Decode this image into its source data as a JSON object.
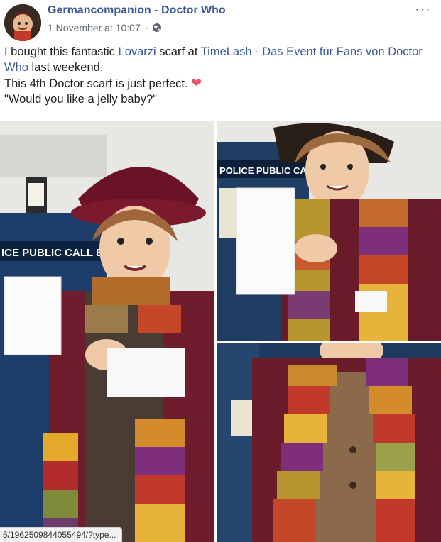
{
  "post": {
    "author": "Germancompanion - Doctor Who",
    "timestamp": "1 November at 10:07",
    "separator": "·",
    "privacy_icon": "globe-icon",
    "more_icon": "more-options-icon",
    "more_label": "···",
    "text": {
      "line1_pre": "I bought this fantastic ",
      "link1": "Lovarzi",
      "line1_mid": " scarf at ",
      "link2": "TimeLash - Das Event für Fans von Doctor Who",
      "line1_post": " last weekend.",
      "line2": "This 4th Doctor scarf is just perfect. ",
      "heart": "❤",
      "line3": "\"Would you like a jelly baby?\""
    }
  },
  "photos": {
    "photo1_sign_text": "ICE PUBLIC CALL BOX",
    "photo2_sign_text": "POLICE PUBLIC CALL BO"
  },
  "status_url": "5/1962509844055494/?type..."
}
